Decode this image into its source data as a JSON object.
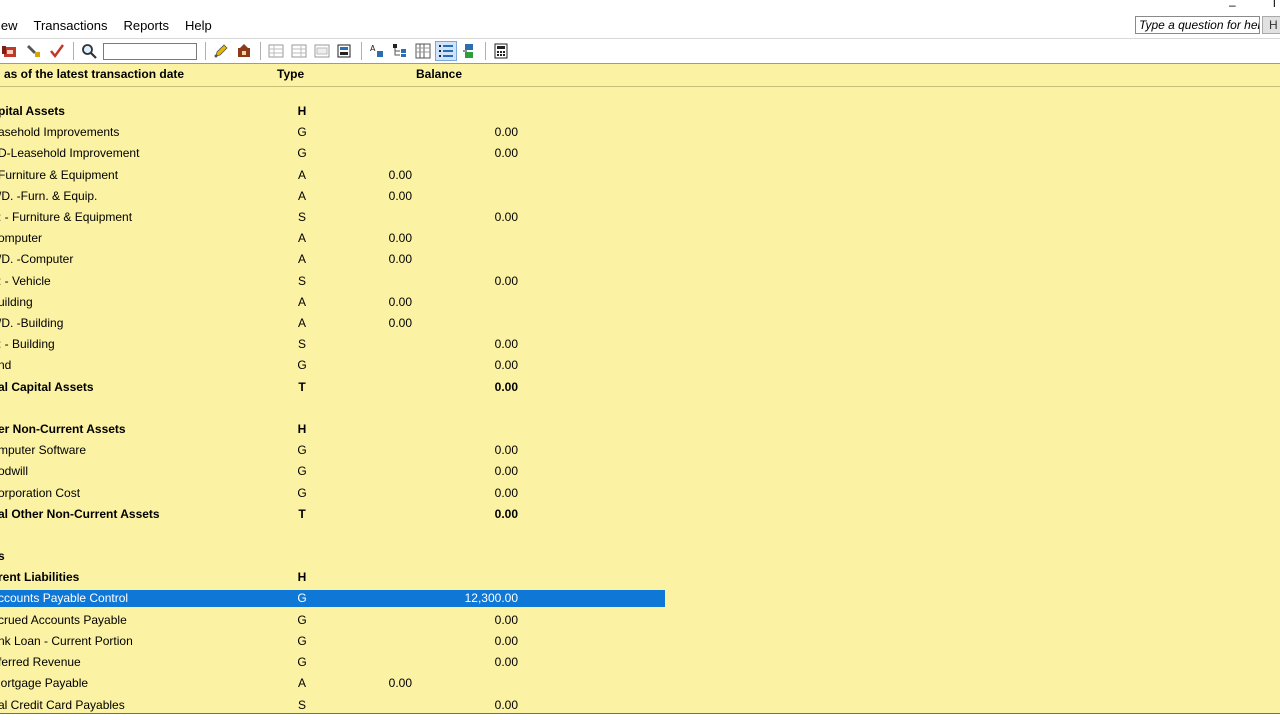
{
  "menu": {
    "items": [
      "iew",
      "Transactions",
      "Reports",
      "Help"
    ],
    "help_placeholder": "Type a question for help",
    "help_button": "H"
  },
  "toolbar": {
    "icons": [
      "delete-record-icon",
      "customize-icon",
      "check-icon",
      "find-icon",
      "edit-icon",
      "journal-icon",
      "grid-view-1-icon",
      "grid-view-2-icon",
      "grid-view-3-icon",
      "export-icon",
      "sort-icon",
      "tree-icon",
      "columns-icon",
      "list-view-icon",
      "refresh-icon",
      "calculator-icon"
    ],
    "search_value": ""
  },
  "report": {
    "headers": {
      "name": "as of the latest transaction date",
      "type": "Type",
      "balance": "Balance"
    },
    "rows": [
      {
        "name": "pital Assets",
        "type": "H",
        "debit": "",
        "credit": "",
        "style": "bold"
      },
      {
        "name": "asehold Improvements",
        "type": "G",
        "debit": "",
        "credit": "0.00",
        "style": ""
      },
      {
        "name": "D-Leasehold Improvement",
        "type": "G",
        "debit": "",
        "credit": "0.00",
        "style": ""
      },
      {
        "name": "Furniture & Equipment",
        "type": "A",
        "debit": "0.00",
        "credit": "",
        "style": ""
      },
      {
        "name": "/D. -Furn. & Equip.",
        "type": "A",
        "debit": "0.00",
        "credit": "",
        "style": ""
      },
      {
        "name": ": - Furniture & Equipment",
        "type": "S",
        "debit": "",
        "credit": "0.00",
        "style": ""
      },
      {
        "name": "omputer",
        "type": "A",
        "debit": "0.00",
        "credit": "",
        "style": ""
      },
      {
        "name": "/D. -Computer",
        "type": "A",
        "debit": "0.00",
        "credit": "",
        "style": ""
      },
      {
        "name": ": - Vehicle",
        "type": "S",
        "debit": "",
        "credit": "0.00",
        "style": ""
      },
      {
        "name": "uilding",
        "type": "A",
        "debit": "0.00",
        "credit": "",
        "style": ""
      },
      {
        "name": "/D. -Building",
        "type": "A",
        "debit": "0.00",
        "credit": "",
        "style": ""
      },
      {
        "name": ": - Building",
        "type": "S",
        "debit": "",
        "credit": "0.00",
        "style": ""
      },
      {
        "name": "nd",
        "type": "G",
        "debit": "",
        "credit": "0.00",
        "style": ""
      },
      {
        "name": "al Capital Assets",
        "type": "T",
        "debit": "",
        "credit": "0.00",
        "style": "bold"
      },
      {
        "name": "",
        "type": "",
        "debit": "",
        "credit": "",
        "style": ""
      },
      {
        "name": "er Non-Current Assets",
        "type": "H",
        "debit": "",
        "credit": "",
        "style": "bold"
      },
      {
        "name": "mputer Software",
        "type": "G",
        "debit": "",
        "credit": "0.00",
        "style": ""
      },
      {
        "name": "odwill",
        "type": "G",
        "debit": "",
        "credit": "0.00",
        "style": ""
      },
      {
        "name": "orporation Cost",
        "type": "G",
        "debit": "",
        "credit": "0.00",
        "style": ""
      },
      {
        "name": "al Other Non-Current Assets",
        "type": "T",
        "debit": "",
        "credit": "0.00",
        "style": "bold"
      },
      {
        "name": "",
        "type": "",
        "debit": "",
        "credit": "",
        "style": ""
      },
      {
        "name": "s",
        "type": "",
        "debit": "",
        "credit": "",
        "style": "bold"
      },
      {
        "name": "rent Liabilities",
        "type": "H",
        "debit": "",
        "credit": "",
        "style": "bold"
      },
      {
        "name": "ccounts Payable Control",
        "type": "G",
        "debit": "",
        "credit": "12,300.00",
        "style": "selected"
      },
      {
        "name": "crued Accounts Payable",
        "type": "G",
        "debit": "",
        "credit": "0.00",
        "style": ""
      },
      {
        "name": "nk Loan - Current Portion",
        "type": "G",
        "debit": "",
        "credit": "0.00",
        "style": ""
      },
      {
        "name": "ferred Revenue",
        "type": "G",
        "debit": "",
        "credit": "0.00",
        "style": ""
      },
      {
        "name": "lortgage Payable",
        "type": "A",
        "debit": "0.00",
        "credit": "",
        "style": ""
      },
      {
        "name": "al Credit Card Payables",
        "type": "S",
        "debit": "",
        "credit": "0.00",
        "style": ""
      }
    ]
  }
}
